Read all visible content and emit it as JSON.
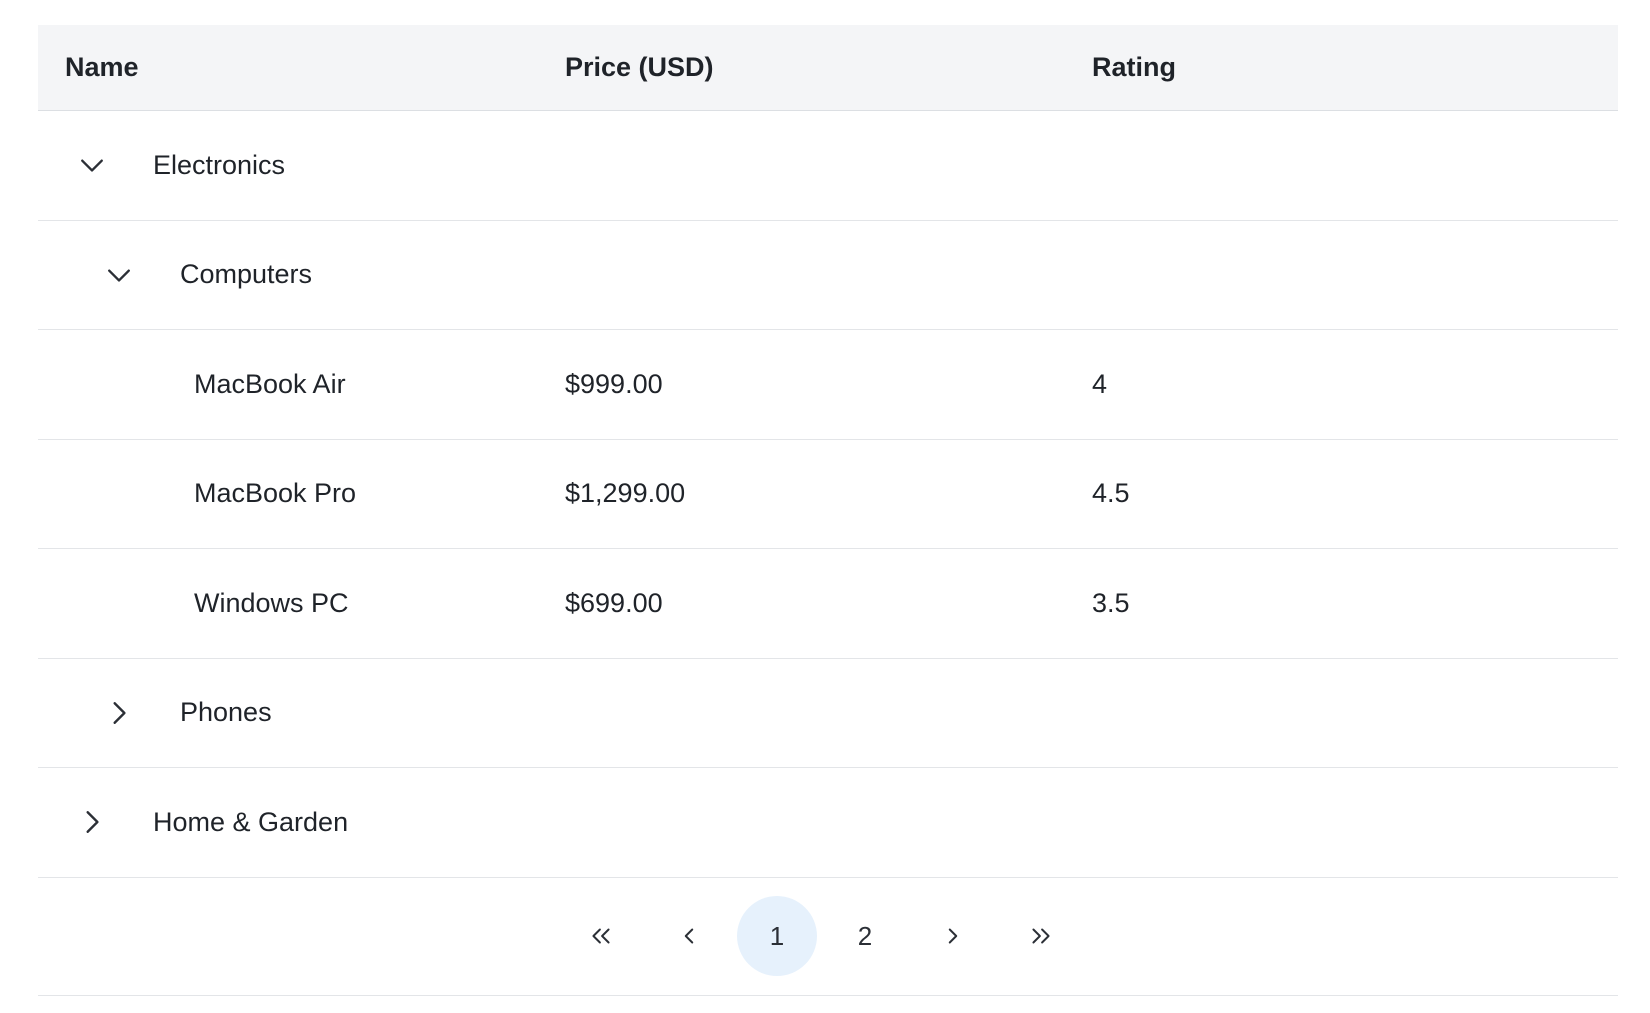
{
  "table": {
    "columns": [
      "Name",
      "Price (USD)",
      "Rating"
    ],
    "rows": [
      {
        "name": "Electronics",
        "price": "",
        "rating": "",
        "level": 0,
        "expanded": true
      },
      {
        "name": "Computers",
        "price": "",
        "rating": "",
        "level": 1,
        "expanded": true
      },
      {
        "name": "MacBook Air",
        "price": "$999.00",
        "rating": "4",
        "level": 2
      },
      {
        "name": "MacBook Pro",
        "price": "$1,299.00",
        "rating": "4.5",
        "level": 2
      },
      {
        "name": "Windows PC",
        "price": "$699.00",
        "rating": "3.5",
        "level": 2
      },
      {
        "name": "Phones",
        "price": "",
        "rating": "",
        "level": 1,
        "expanded": false
      },
      {
        "name": "Home & Garden",
        "price": "",
        "rating": "",
        "level": 0,
        "expanded": false
      }
    ]
  },
  "pagination": {
    "pages": [
      "1",
      "2"
    ],
    "current_page": "1",
    "icons": {
      "first": "double-chevron-left-icon",
      "prev": "chevron-left-icon",
      "next": "chevron-right-icon",
      "last": "double-chevron-right-icon"
    }
  },
  "colors": {
    "header_bg": "#f4f5f7",
    "active_page_bg": "#e6f1fc",
    "border": "#e3e5e8",
    "text": "#1f2329"
  }
}
